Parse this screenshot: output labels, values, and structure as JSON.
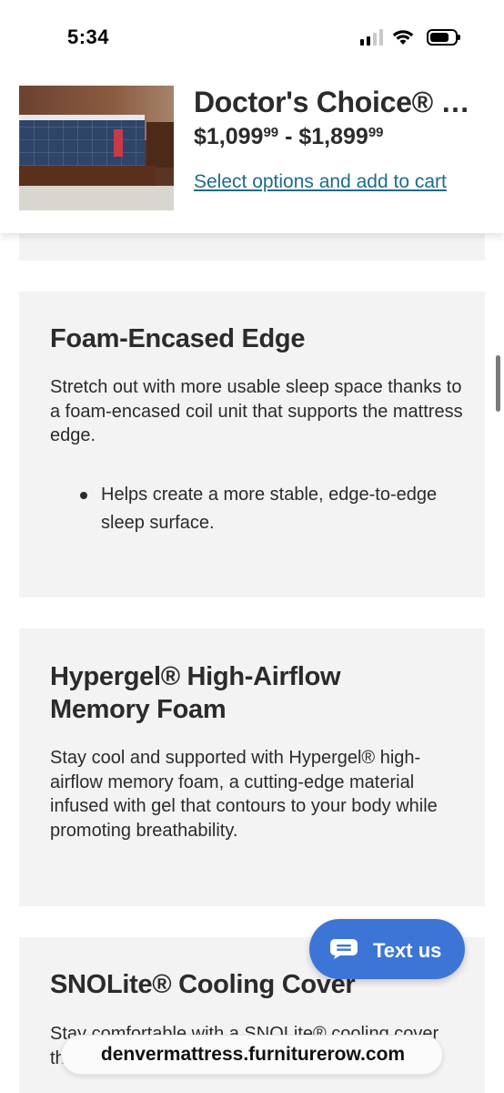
{
  "status_bar": {
    "time": "5:34",
    "signal_bars_active": 2,
    "signal_bars_total": 4,
    "battery_level": 0.75
  },
  "product": {
    "title": "Doctor's Choice® Plush Hybrid Mattress",
    "price_low_main": "$1,099",
    "price_low_cents": "99",
    "price_separator": " - ",
    "price_high_main": "$1,899",
    "price_high_cents": "99",
    "cta_link": "Select options and add to cart",
    "image_icon": "mattress-product-thumbnail"
  },
  "features": [
    {
      "title": "Foam-Encased Edge",
      "body": "Stretch out with more usable sleep space thanks to a foam-encased coil unit that supports the mattress edge.",
      "bullets": [
        "Helps create a more stable, edge-to-edge sleep surface."
      ]
    },
    {
      "title": "Hypergel® High-Airflow Memory Foam",
      "body": "Stay cool and supported with Hypergel® high-airflow memory foam, a cutting-edge material infused with gel that contours to your body while promoting breathability."
    },
    {
      "title": "SNOLite® Cooling Cover",
      "body": "Stay comfortable with a SNOLite® cooling cover that helps help regulate temperature."
    }
  ],
  "chat": {
    "label": "Text us",
    "icon": "chat-bubble-icon",
    "color": "#3d75d6"
  },
  "browser": {
    "url": "denvermattress.furniturerow.com"
  },
  "colors": {
    "link": "#1f6b8a",
    "card_background": "#f4f3f3",
    "text": "#2b2b2b"
  }
}
